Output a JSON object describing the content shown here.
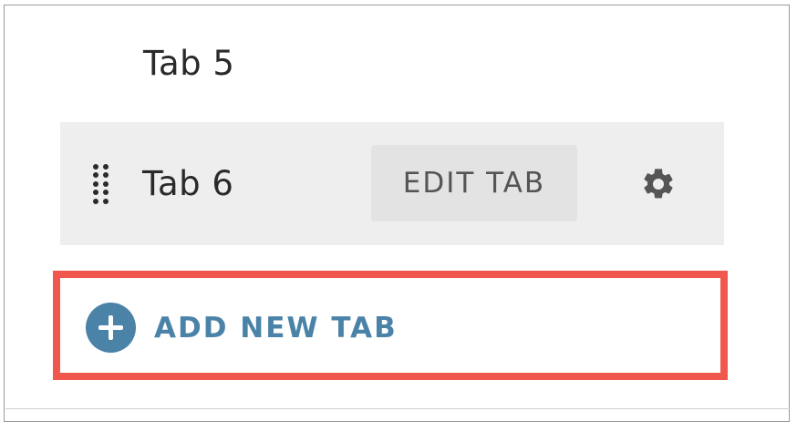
{
  "tabs": [
    {
      "label": "Tab 5"
    },
    {
      "label": "Tab 6",
      "edit_label": "EDIT TAB",
      "settings_icon": "gear-icon",
      "drag_icon": "drag-handle-icon"
    }
  ],
  "add_tab": {
    "label": "ADD NEW TAB",
    "icon": "plus-circle-icon"
  },
  "colors": {
    "accent": "#4a82a8",
    "highlight": "#f0584d",
    "row_selected_bg": "#eeeeee"
  }
}
